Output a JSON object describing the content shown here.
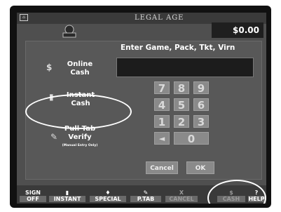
{
  "header": {
    "legal_age": "LEGAL AGE",
    "balance": "$0.00"
  },
  "prompt": "Enter Game, Pack, Tkt, Virn",
  "entry_value": "",
  "options": {
    "online": [
      "Online",
      "Cash"
    ],
    "instant": [
      "Instant",
      "Cash"
    ],
    "pulltab": [
      "Pull Tab",
      "Verify"
    ],
    "pulltab_note": "(Manual Entry Only)"
  },
  "keypad": {
    "rows": [
      [
        "7",
        "8",
        "9"
      ],
      [
        "4",
        "5",
        "6"
      ],
      [
        "1",
        "2",
        "3"
      ]
    ],
    "back": "◄",
    "zero": "0",
    "cancel": "Cancel",
    "ok": "OK"
  },
  "bottom_bar": [
    {
      "top": "SIGN",
      "bottom": "OFF"
    },
    {
      "top": "",
      "bottom": "INSTANT"
    },
    {
      "top": "",
      "bottom": "SPECIAL"
    },
    {
      "top": "",
      "bottom": "P.TAB"
    },
    {
      "top": "X",
      "bottom": "CANCEL"
    },
    {
      "top": "$",
      "bottom": "CASH"
    },
    {
      "top": "?",
      "bottom": "HELP"
    }
  ],
  "icons": {
    "corner": "dealer-icon",
    "online": "dollar-sign-icon",
    "instant": "ticket-icon",
    "pulltab": "pen-icon"
  }
}
